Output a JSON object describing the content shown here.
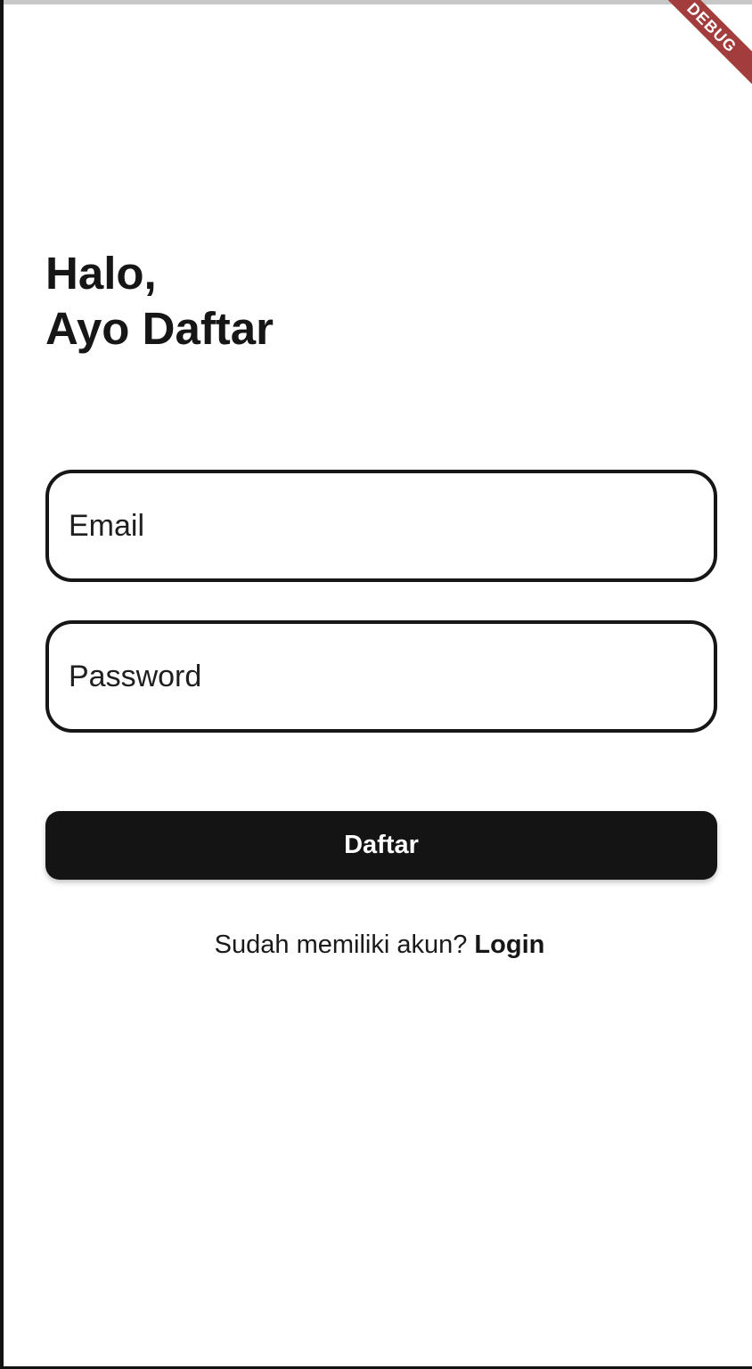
{
  "debug_banner": {
    "label": "DEBUG"
  },
  "header": {
    "line1": "Halo,",
    "line2": "Ayo Daftar"
  },
  "form": {
    "email": {
      "placeholder": "Email",
      "value": ""
    },
    "password": {
      "placeholder": "Password",
      "value": ""
    },
    "submit_label": "Daftar"
  },
  "footer": {
    "prompt": "Sudah memiliki akun? ",
    "login_label": "Login"
  },
  "colors": {
    "primary": "#141414",
    "background": "#ffffff",
    "debug_ribbon": "#a33d3d"
  }
}
